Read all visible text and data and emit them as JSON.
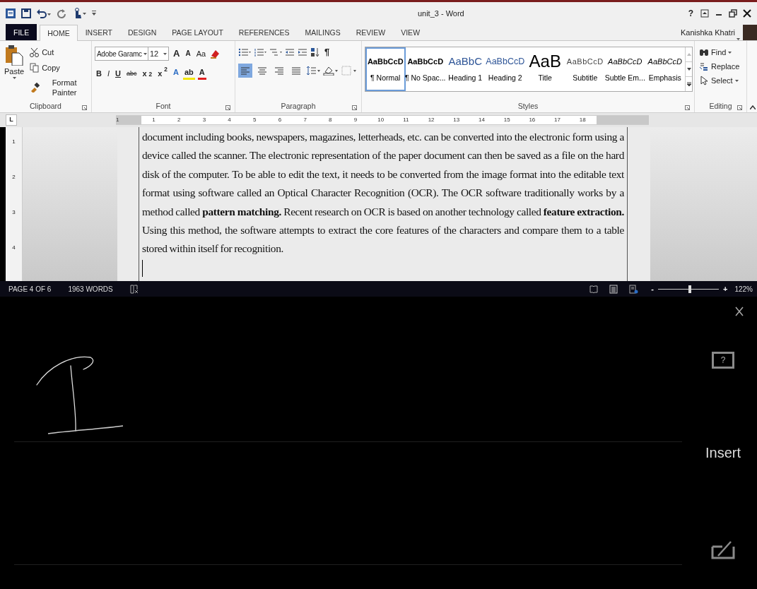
{
  "window": {
    "title": "unit_3 - Word",
    "help": "?"
  },
  "user": {
    "name": "Kanishka Khatri"
  },
  "tabs": [
    {
      "label": "FILE",
      "kind": "file",
      "selected": false
    },
    {
      "label": "HOME",
      "kind": "tab",
      "selected": true
    },
    {
      "label": "INSERT",
      "kind": "tab",
      "selected": false
    },
    {
      "label": "DESIGN",
      "kind": "tab",
      "selected": false
    },
    {
      "label": "PAGE LAYOUT",
      "kind": "tab",
      "selected": false
    },
    {
      "label": "REFERENCES",
      "kind": "tab",
      "selected": false
    },
    {
      "label": "MAILINGS",
      "kind": "tab",
      "selected": false
    },
    {
      "label": "REVIEW",
      "kind": "tab",
      "selected": false
    },
    {
      "label": "VIEW",
      "kind": "tab",
      "selected": false
    }
  ],
  "clipboard": {
    "label": "Clipboard",
    "paste": "Paste",
    "items": [
      {
        "label": "Cut",
        "kind": "cut"
      },
      {
        "label": "Copy",
        "kind": "copy"
      },
      {
        "label": "Format Painter",
        "kind": "painter"
      }
    ]
  },
  "font": {
    "label": "Font",
    "name": "Adobe Garamc",
    "size": "12",
    "size_buttons": [
      "A",
      "A"
    ],
    "case_button": "Aa",
    "format_buttons": [
      {
        "label": "B",
        "kind": "bold"
      },
      {
        "label": "I",
        "kind": "italic"
      },
      {
        "label": "U",
        "kind": "underline"
      },
      {
        "label": "abc",
        "kind": "strike"
      },
      {
        "label": "x$_{2}$",
        "kind": "sub"
      },
      {
        "label": "x$^{2}$",
        "kind": "sup"
      }
    ],
    "color_buttons": [
      {
        "label": "A",
        "kind": "effects"
      },
      {
        "label": "ab",
        "kind": "highlight"
      },
      {
        "label": "A",
        "kind": "font_color"
      }
    ]
  },
  "paragraph": {
    "label": "Paragraph",
    "pilcrow": "¶",
    "alignment": [
      {
        "kind": "left",
        "selected": true
      },
      {
        "kind": "center",
        "selected": false
      },
      {
        "kind": "right",
        "selected": false
      },
      {
        "kind": "justify",
        "selected": false
      }
    ]
  },
  "styles": {
    "label": "Styles",
    "items": [
      {
        "preview": "AaBbCcD",
        "name": "¶ Normal",
        "kind": "normal",
        "selected": true
      },
      {
        "preview": "AaBbCcD",
        "name": "¶ No Spac...",
        "kind": "normal",
        "selected": false
      },
      {
        "preview": "AaBbC",
        "name": "Heading 1",
        "kind": "heading1",
        "selected": false
      },
      {
        "preview": "AaBbCcD",
        "name": "Heading 2",
        "kind": "heading2",
        "selected": false
      },
      {
        "preview": "AaB",
        "name": "Title",
        "kind": "title",
        "selected": false
      },
      {
        "preview": "AaBbCcD",
        "name": "Subtitle",
        "kind": "subtitle",
        "selected": false
      },
      {
        "preview": "AaBbCcD",
        "name": "Subtle Em...",
        "kind": "emphasis",
        "selected": false
      },
      {
        "preview": "AaBbCcD",
        "name": "Emphasis",
        "kind": "emphasis",
        "selected": false
      }
    ]
  },
  "editing": {
    "label": "Editing",
    "items": [
      {
        "label": "Find",
        "kind": "find"
      },
      {
        "label": "Replace",
        "kind": "replace"
      },
      {
        "label": "Select",
        "kind": "select"
      }
    ]
  },
  "ruler": {
    "tab_selector": "L",
    "marks": [
      "1",
      "1",
      "2",
      "3",
      "4",
      "5",
      "6",
      "7",
      "8",
      "9",
      "10",
      "11",
      "12",
      "13",
      "14",
      "15",
      "16",
      "17",
      "18"
    ],
    "vertical_marks": [
      "1",
      "2",
      "3",
      "4"
    ]
  },
  "document": {
    "paragraph": "document including books, newspapers, magazines, letterheads, etc. can be converted into the electronic form using a device called the scanner. The electronic representation of the paper document can then be saved as a file on the hard disk of the computer. To be able to edit the text, it needs to be converted from the image format into the editable text format using software called an Optical Character Recognition (OCR). The OCR software traditionally works by a method called **pattern matching.** Recent research on OCR is based on another technology called **feature extraction.** Using this method, the software attempts to extract the core features of the characters and compare them to a table stored within itself for recognition."
  },
  "status_bar": {
    "page": "PAGE 4 OF 6",
    "words": "1963 WORDS",
    "zoom_out": "-",
    "zoom_in": "+",
    "zoom": "122%",
    "zoom_slider": {
      "level": 0.52
    }
  },
  "ink_panel": {
    "help": "?",
    "action": "Insert"
  }
}
